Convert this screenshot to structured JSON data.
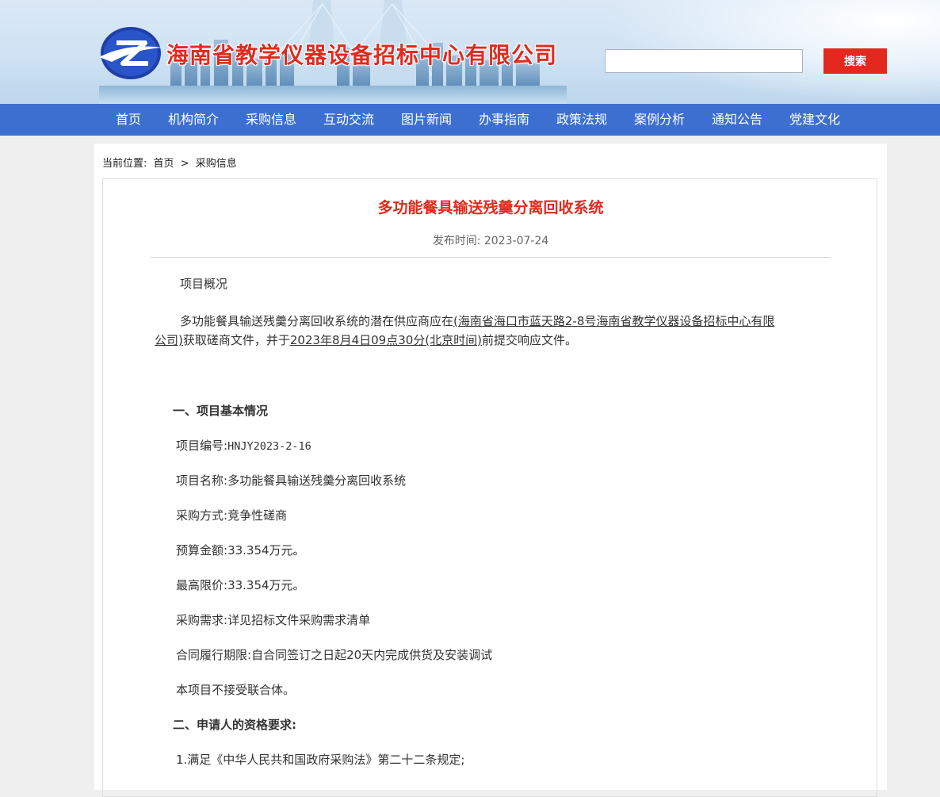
{
  "header": {
    "site_title": "海南省教学仪器设备招标中心有限公司",
    "search": {
      "value": "",
      "placeholder": ""
    },
    "search_button_label": "搜索",
    "colors": {
      "accent_red": "#e3281d",
      "nav_blue": "#3d6fd1"
    },
    "logo_icon": "z-logo-icon"
  },
  "nav": {
    "items": [
      "首页",
      "机构简介",
      "采购信息",
      "互动交流",
      "图片新闻",
      "办事指南",
      "政策法规",
      "案例分析",
      "通知公告",
      "党建文化"
    ]
  },
  "breadcrumb": {
    "label": "当前位置:",
    "home": "首页",
    "separator": ">",
    "current": "采购信息"
  },
  "article": {
    "title": "多功能餐具输送残羹分离回收系统",
    "publish_label": "发布时间:",
    "publish_date": "2023-07-24",
    "overview_heading": "项目概况",
    "intro": {
      "part1": "多功能餐具输送残羹分离回收系统的潜在供应商应在",
      "address_line1": "(海南省海口市蓝天路2-8号海南省教学仪器设备招标中心有限",
      "address_line2": "公司)",
      "part2": "获取磋商文件，并于",
      "deadline": "2023年8月4日09点30分(北京时间)",
      "part3": "前提交响应文件。"
    },
    "section1_heading": "一、项目基本情况",
    "project_no_label": "项目编号:",
    "project_no": "HNJY2023-2-16",
    "project_name_label": "项目名称:",
    "project_name": "多功能餐具输送残羹分离回收系统",
    "method_label": "采购方式:",
    "method": "竞争性磋商",
    "budget_label": "预算金额:",
    "budget": "33.354万元。",
    "max_price_label": "最高限价:",
    "max_price": "33.354万元。",
    "demand_label": "采购需求:",
    "demand": "详见招标文件采购需求清单",
    "term_label": "合同履行期限:",
    "term": "自合同签订之日起20天内完成供货及安装调试",
    "consortium": "本项目不接受联合体。",
    "section2_heading": "二、申请人的资格要求:",
    "req1": "1.满足《中华人民共和国政府采购法》第二十二条规定;"
  }
}
